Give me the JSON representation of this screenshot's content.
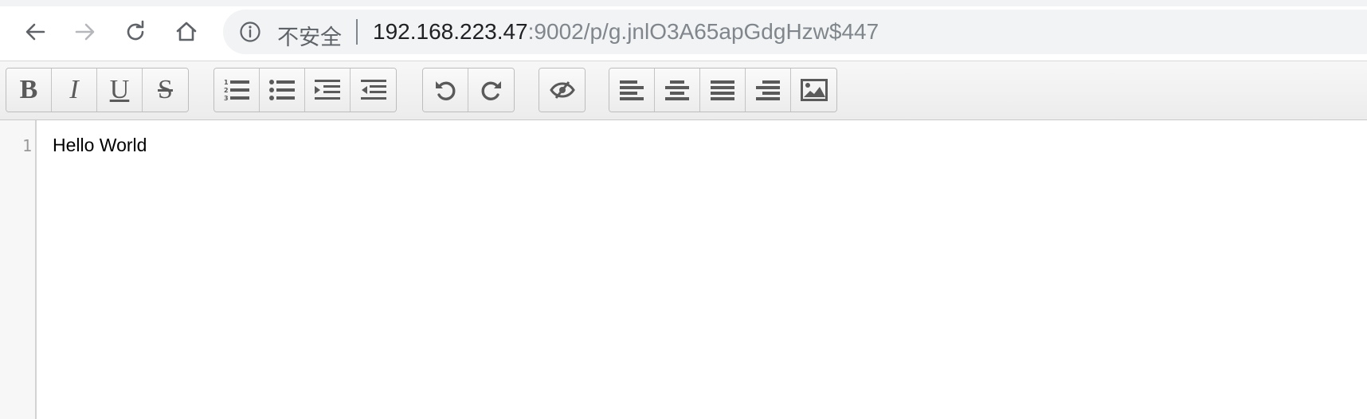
{
  "browser": {
    "nav": [
      {
        "icon": "back-arrow-icon",
        "enabled": true
      },
      {
        "icon": "forward-arrow-icon",
        "enabled": false
      },
      {
        "icon": "reload-icon",
        "enabled": true
      },
      {
        "icon": "home-icon",
        "enabled": true
      }
    ],
    "security_label": "不安全",
    "url_host": "192.168.223.47",
    "url_rest": ":9002/p/g.jnlO3A65apGdgHzw$447"
  },
  "toolbar": {
    "groups": [
      {
        "name": "text-style",
        "buttons": [
          {
            "name": "bold-button",
            "label": "B",
            "icon": "bold-icon"
          },
          {
            "name": "italic-button",
            "label": "I",
            "icon": "italic-icon"
          },
          {
            "name": "underline-button",
            "label": "U",
            "icon": "underline-icon"
          },
          {
            "name": "strikethrough-button",
            "label": "S",
            "icon": "strikethrough-icon"
          }
        ]
      },
      {
        "name": "lists",
        "buttons": [
          {
            "name": "ordered-list-button",
            "icon": "ordered-list-icon"
          },
          {
            "name": "unordered-list-button",
            "icon": "unordered-list-icon"
          },
          {
            "name": "indent-button",
            "icon": "indent-icon"
          },
          {
            "name": "outdent-button",
            "icon": "outdent-icon"
          }
        ]
      },
      {
        "name": "history",
        "buttons": [
          {
            "name": "undo-button",
            "icon": "undo-icon"
          },
          {
            "name": "redo-button",
            "icon": "redo-icon"
          }
        ]
      },
      {
        "name": "visibility",
        "buttons": [
          {
            "name": "toggle-authorship-button",
            "icon": "eye-slash-icon"
          }
        ]
      },
      {
        "name": "alignment",
        "buttons": [
          {
            "name": "align-left-button",
            "icon": "align-left-icon"
          },
          {
            "name": "align-center-button",
            "icon": "align-center-icon"
          },
          {
            "name": "align-justify-button",
            "icon": "align-justify-icon"
          },
          {
            "name": "align-right-button",
            "icon": "align-right-icon"
          },
          {
            "name": "insert-image-button",
            "icon": "image-icon"
          }
        ]
      }
    ]
  },
  "editor": {
    "lines": [
      {
        "number": "1",
        "text": "Hello World"
      }
    ]
  },
  "colors": {
    "icon_gray": "#5a5a5a",
    "omnibox_bg": "#f1f3f4",
    "toolbar_bg": "#f0f0f0"
  }
}
